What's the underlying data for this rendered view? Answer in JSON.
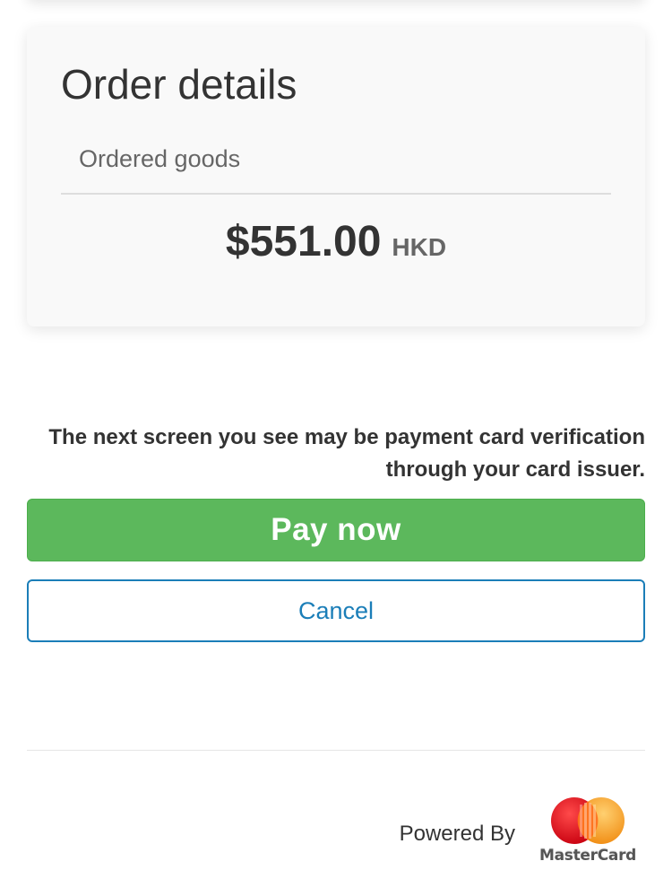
{
  "order": {
    "title": "Order details",
    "item_label": "Ordered goods",
    "amount": "$551.00",
    "currency": "HKD"
  },
  "notice": "The next screen you see may be payment card verification through your card issuer.",
  "actions": {
    "pay_label": "Pay now",
    "cancel_label": "Cancel"
  },
  "footer": {
    "powered_by": "Powered By",
    "brand": "MasterCard"
  },
  "colors": {
    "pay_button": "#5cb85c",
    "cancel_accent": "#1b7eb8",
    "mastercard_red": "#eb001b",
    "mastercard_orange": "#f79e1b"
  }
}
